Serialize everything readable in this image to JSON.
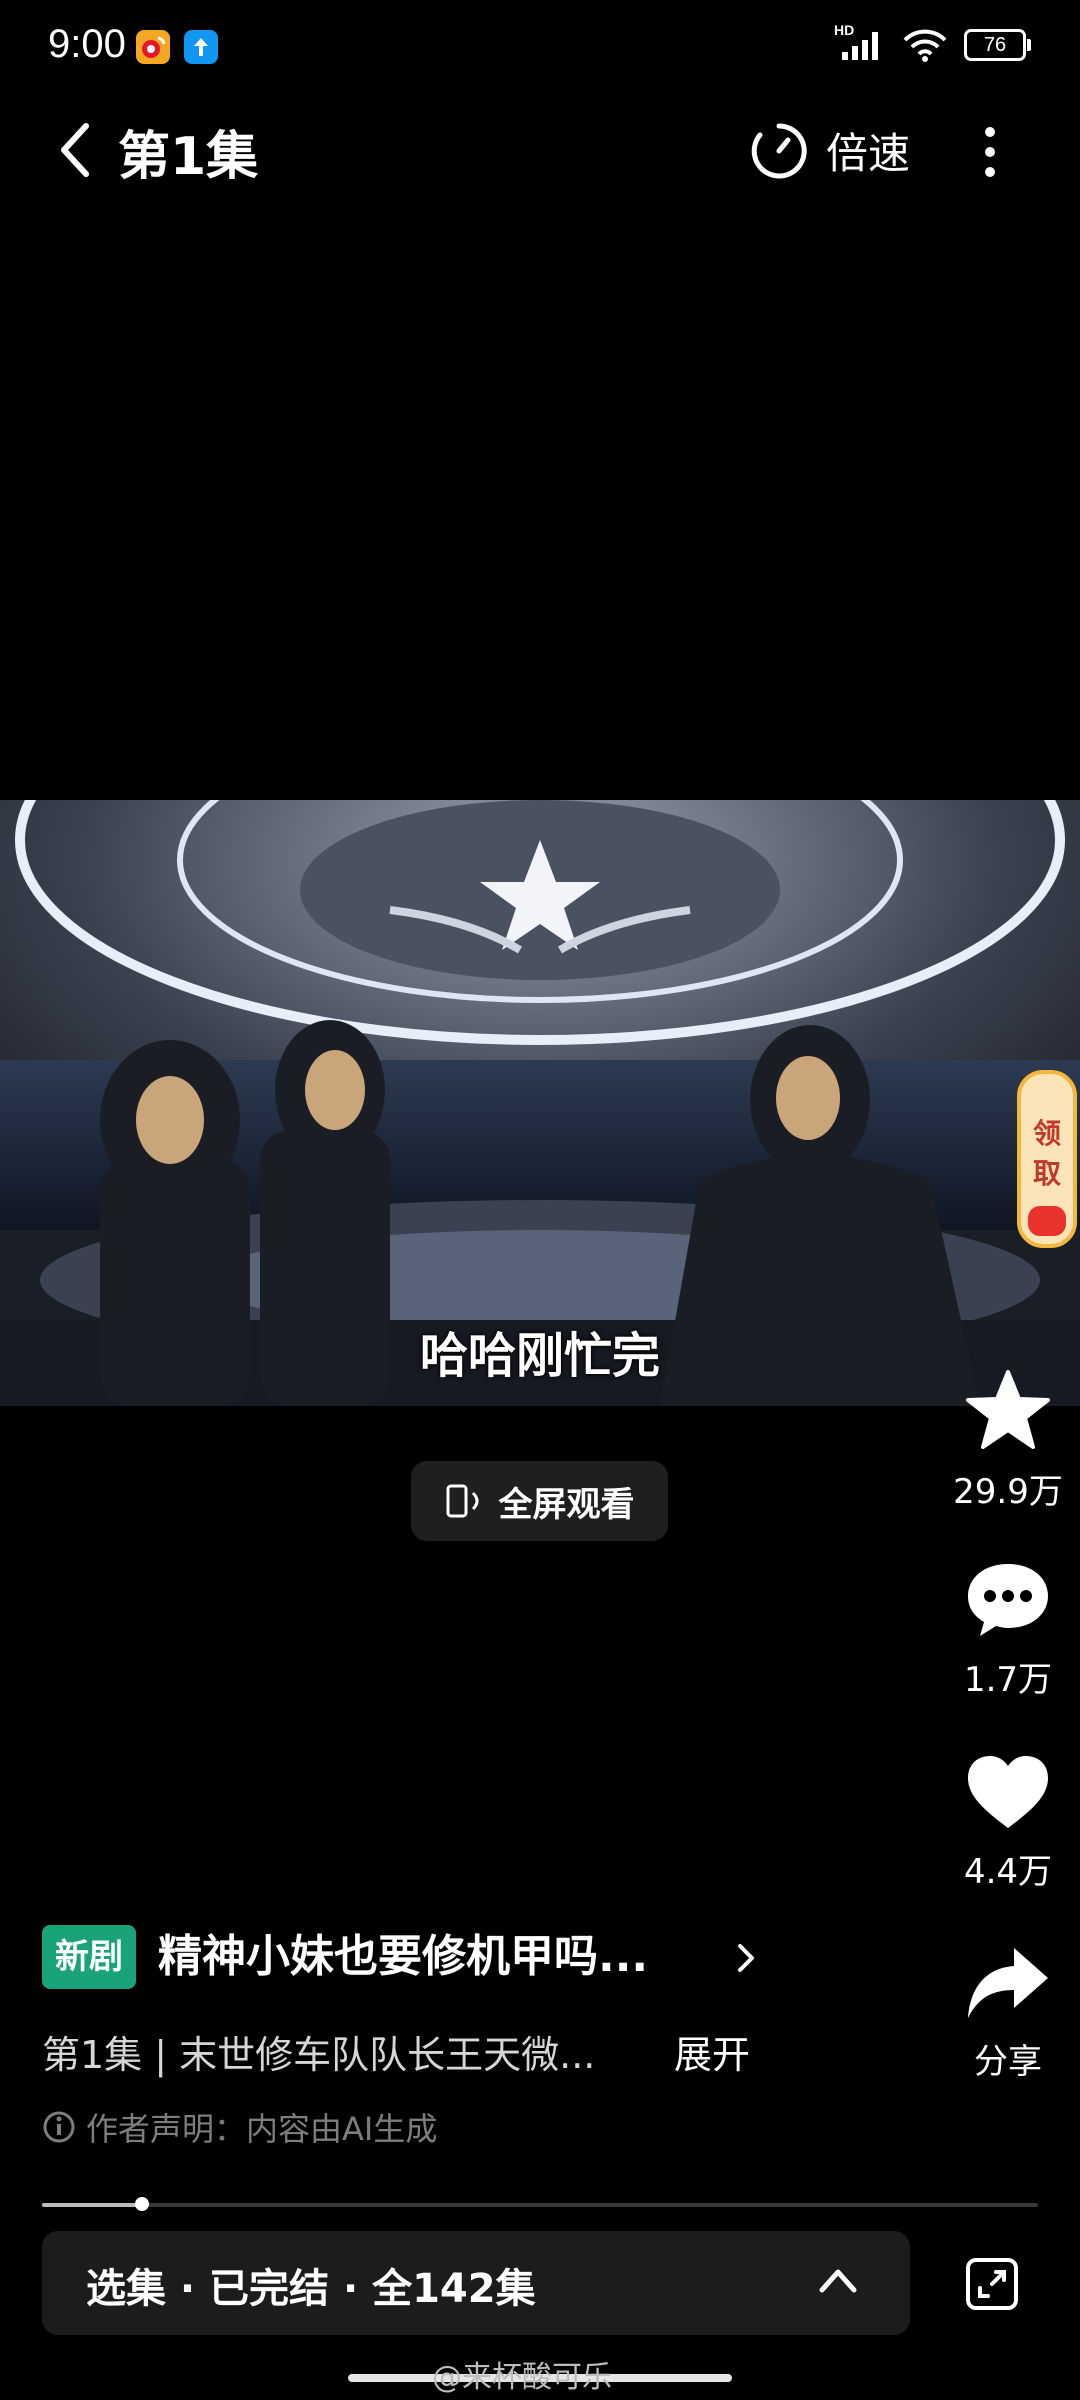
{
  "status_bar": {
    "time": "9:00",
    "network_label": "HD",
    "battery": "76"
  },
  "topbar": {
    "title": "第1集",
    "speed_label": "倍速"
  },
  "video": {
    "subtitle": "哈哈刚忙完",
    "claim_label_line1": "领",
    "claim_label_line2": "取"
  },
  "fullscreen": {
    "label": "全屏观看"
  },
  "actions": {
    "favorite_count": "29.9万",
    "comment_count": "1.7万",
    "like_count": "4.4万",
    "share_label": "分享"
  },
  "info": {
    "new_badge": "新剧",
    "drama_title": "精神小妹也要修机甲吗...",
    "description": "第1集 | 末世修车队队长王天微...",
    "expand_label": "展开",
    "disclaimer": "作者声明：内容由AI生成"
  },
  "playback": {
    "progress": 0.1
  },
  "episode_bar": {
    "text": "选集 · 已完结 · 全142集"
  },
  "watermark": "@来杯酸可乐",
  "colors": {
    "background": "#000000",
    "badge_green": "#1aa37a",
    "bar_bg": "#1c1c1e"
  }
}
